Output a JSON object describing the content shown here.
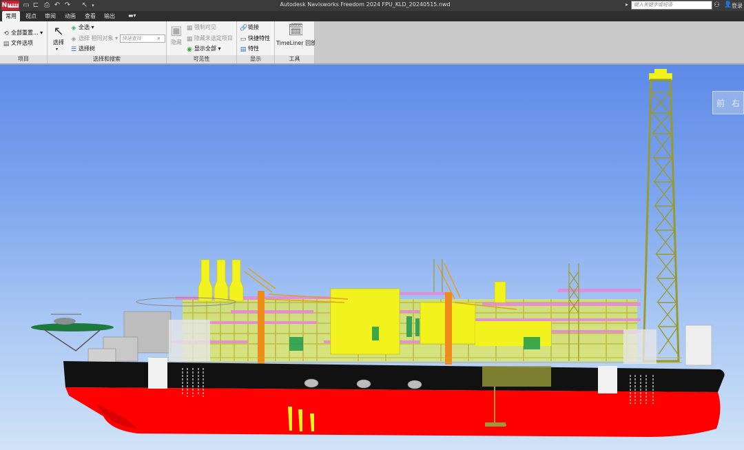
{
  "app": {
    "logo_text": "N",
    "logo_badge": "FREE",
    "window_title": "Autodesk Navisworks Freedom 2024    FPU_KLD_20240515.nwd",
    "search_placeholder": "键入关键字或短语",
    "login": "登录"
  },
  "tabs": [
    {
      "label": "常用",
      "active": true
    },
    {
      "label": "视点"
    },
    {
      "label": "审阅"
    },
    {
      "label": "动画"
    },
    {
      "label": "查看"
    },
    {
      "label": "输出"
    }
  ],
  "ribbon": {
    "project": {
      "label": "项目",
      "reset_all": "全部重置...",
      "file_options": "文件选项"
    },
    "select_search": {
      "label": "选择和搜索",
      "select": "选择",
      "select_all": "全选",
      "select_same": "选择 相同对象",
      "quick_find_placeholder": "快速查找",
      "selection_tree": "选择树"
    },
    "visibility": {
      "label": "可见性",
      "hide": "隐藏",
      "require": "强制可见",
      "hide_unselected": "隐藏未选定项目",
      "unhide_all": "显示全部"
    },
    "display": {
      "label": "显示",
      "links": "链接",
      "quick_properties": "快捷特性",
      "properties": "特性"
    },
    "tools": {
      "label": "工具",
      "timeliner": "TimeLiner 回放"
    }
  },
  "viewcube": {
    "front": "前",
    "right": "右"
  },
  "colors": {
    "hull_red": "#ff0000",
    "hull_black": "#111111",
    "topside_yellow": "#f2f21e",
    "crane_orange": "#f08a1a",
    "frame_olive": "#b8b83a",
    "magenta_deck": "#e68ad6",
    "helideck_green": "#1e7a3c"
  }
}
